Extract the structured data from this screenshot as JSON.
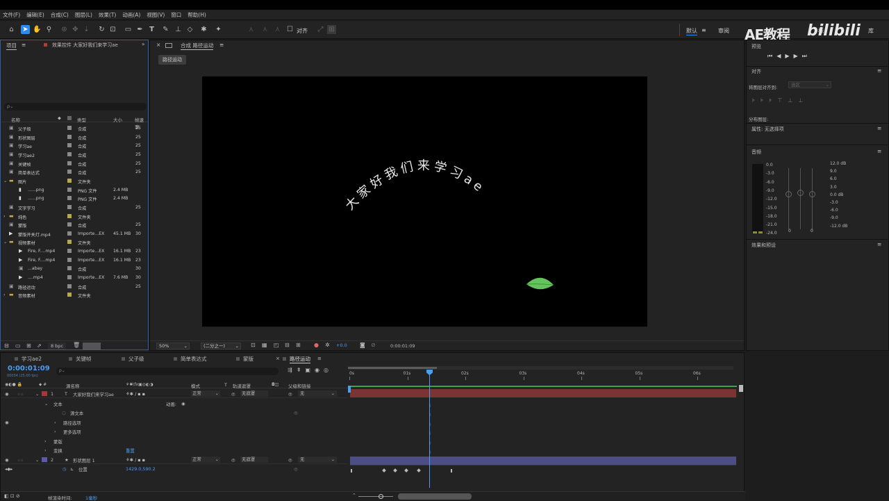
{
  "menu": [
    "文件(F)",
    "编辑(E)",
    "合成(C)",
    "图层(L)",
    "效果(T)",
    "动画(A)",
    "视图(V)",
    "窗口",
    "帮助(H)"
  ],
  "toolbar": {
    "align_label": "对齐",
    "workspace_default": "默认",
    "workspace_review": "审阅",
    "workspace_standard": "标",
    "workspace_library": "库"
  },
  "watermark": {
    "ae": "AE教程",
    "site": "bilibili"
  },
  "project": {
    "tab_project": "项目",
    "tab_effects": "效果控件 大家好我们来学习ae",
    "search_placeholder": "ρ⌄",
    "columns": {
      "name": "名称",
      "type": "类型",
      "size": "大小",
      "fps": "帧速率"
    },
    "items": [
      {
        "name": "父子级",
        "type": "合成",
        "size": "",
        "fps": "25",
        "kind": "comp",
        "indent": 0,
        "label": "#8a8a8a"
      },
      {
        "name": "形状图层",
        "type": "合成",
        "size": "",
        "fps": "25",
        "kind": "comp",
        "indent": 0,
        "label": "#8a8a8a"
      },
      {
        "name": "学习ae",
        "type": "合成",
        "size": "",
        "fps": "25",
        "kind": "comp",
        "indent": 0,
        "label": "#8a8a8a"
      },
      {
        "name": "学习ae2",
        "type": "合成",
        "size": "",
        "fps": "25",
        "kind": "comp",
        "indent": 0,
        "label": "#8a8a8a"
      },
      {
        "name": "关键帧",
        "type": "合成",
        "size": "",
        "fps": "25",
        "kind": "comp",
        "indent": 0,
        "label": "#8a8a8a"
      },
      {
        "name": "简单表达式",
        "type": "合成",
        "size": "",
        "fps": "25",
        "kind": "comp",
        "indent": 0,
        "label": "#8a8a8a"
      },
      {
        "name": "图片",
        "type": "文件夹",
        "size": "",
        "fps": "",
        "kind": "folder-open",
        "indent": 0,
        "label": "#b8a94a"
      },
      {
        "name": "......png",
        "type": "PNG 文件",
        "size": "2.4 MB",
        "fps": "",
        "kind": "file",
        "indent": 1,
        "label": "#8a8a8a"
      },
      {
        "name": "......png",
        "type": "PNG 文件",
        "size": "2.4 MB",
        "fps": "",
        "kind": "file",
        "indent": 1,
        "label": "#8a8a8a"
      },
      {
        "name": "文字学习",
        "type": "合成",
        "size": "",
        "fps": "25",
        "kind": "comp",
        "indent": 0,
        "label": "#8a8a8a"
      },
      {
        "name": "纯色",
        "type": "文件夹",
        "size": "",
        "fps": "",
        "kind": "folder",
        "indent": 0,
        "label": "#b8a94a"
      },
      {
        "name": "蒙版",
        "type": "合成",
        "size": "",
        "fps": "25",
        "kind": "comp",
        "indent": 0,
        "label": "#8a8a8a"
      },
      {
        "name": "蒙版开关灯.mp4",
        "type": "Importe...EX",
        "size": "45.1 MB",
        "fps": "30",
        "kind": "video",
        "indent": 0,
        "label": "#8a8a8a"
      },
      {
        "name": "视频素材",
        "type": "文件夹",
        "size": "",
        "fps": "",
        "kind": "folder-open",
        "indent": 0,
        "label": "#b8a94a"
      },
      {
        "name": "Fire, F....mp4",
        "type": "Importe...EX",
        "size": "16.1 MB",
        "fps": "23",
        "kind": "video",
        "indent": 1,
        "label": "#8a8a8a"
      },
      {
        "name": "Fire, F....mp4",
        "type": "Importe...EX",
        "size": "16.1 MB",
        "fps": "23",
        "kind": "video",
        "indent": 1,
        "label": "#8a8a8a"
      },
      {
        "name": "...abay",
        "type": "合成",
        "size": "",
        "fps": "30",
        "kind": "comp",
        "indent": 1,
        "label": "#8a8a8a"
      },
      {
        "name": "....mp4",
        "type": "Importe...EX",
        "size": "7.6 MB",
        "fps": "30",
        "kind": "video",
        "indent": 1,
        "label": "#8a8a8a"
      },
      {
        "name": "路径运动",
        "type": "合成",
        "size": "",
        "fps": "25",
        "kind": "comp",
        "indent": 0,
        "label": "#8a8a8a"
      },
      {
        "name": "音频素材",
        "type": "文件夹",
        "size": "",
        "fps": "",
        "kind": "folder",
        "indent": 0,
        "label": "#b8a94a"
      }
    ],
    "bpc": "8 bpc"
  },
  "composition": {
    "tab": "合成 路径运动",
    "subtab": "路径运动",
    "canvas_text": "大家好我们来学习ae",
    "zoom": "50%",
    "resolution": "(二分之一)",
    "exposure": "+0.0",
    "timecode": "0:00:01:09"
  },
  "right": {
    "preview_title": "预览",
    "align_title": "对齐",
    "align_to_label": "将图层对齐到:",
    "align_to_value": "选区",
    "distribute_label": "分布图层:",
    "properties_label": "属性: 无选择项",
    "audio_title": "音频",
    "audio_left": [
      "0.0",
      "-3.0",
      "-6.0",
      "-9.0",
      "-12.0",
      "-15.0",
      "-18.0",
      "-21.0",
      "-24.0"
    ],
    "audio_right": [
      "12.0 dB",
      "9.0",
      "6.0",
      "3.0",
      "0.0 dB",
      "-3.0",
      "-6.0",
      "-9.0",
      "-12.0 dB"
    ],
    "audio_zero_l": "0",
    "audio_zero_r": "0",
    "effects_title": "效果和预设"
  },
  "timeline": {
    "tabs": [
      "学习ae2",
      "关键帧",
      "父子级",
      "简单表达式",
      "蒙版",
      "路径运动"
    ],
    "active_tab": 5,
    "timecode": "0:00:01:09",
    "frame_info": "00034 (25.00 fps)",
    "headers": {
      "source_name": "源名称",
      "mode": "模式",
      "t": "T",
      "trkmat": "轨道遮罩",
      "parent": "父级和链接"
    },
    "ruler": [
      "0s",
      "01s",
      "02s",
      "03s",
      "04s",
      "05s",
      "06s"
    ],
    "layers": [
      {
        "num": "1",
        "name": "大家好我们来学习ae",
        "mode": "正常",
        "matte": "无遮罩",
        "parent": "无",
        "color": "#a03a3a"
      },
      {
        "num": "2",
        "name": "形状图层 1",
        "mode": "正常",
        "matte": "无遮罩",
        "parent": "无",
        "color": "#5a5aa8"
      }
    ],
    "props": {
      "text": "文本",
      "animate": "动画:",
      "source_text": "源文本",
      "path_options": "路径选项",
      "more_options": "更多选项",
      "masks": "蒙版",
      "transform": "变换",
      "reset": "重置",
      "position": "位置",
      "position_value": "1429.0,590.2"
    },
    "footer_label": "帧渲染时间:",
    "footer_value": "1毫秒"
  }
}
